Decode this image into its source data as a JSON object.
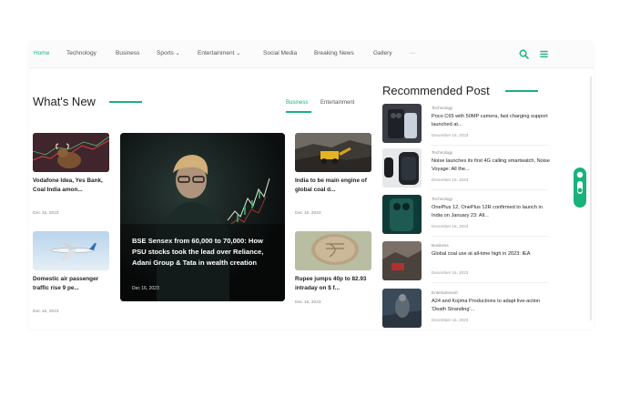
{
  "nav": {
    "items": [
      "Home",
      "Technology",
      "Business",
      "Sports",
      "Entertainment",
      "Social Media",
      "Breaking News",
      "Gallery",
      "···"
    ],
    "chevron": "⌄"
  },
  "whats_new": {
    "title": "What's New",
    "tabs": [
      "Business",
      "Entertainment"
    ]
  },
  "articles": {
    "vodafone": {
      "title": "Vodafone Idea, Yes Bank, Coal India amon...",
      "date": "Dec 16, 2023"
    },
    "air": {
      "title": "Domestic air passenger traffic rise 9 pe...",
      "date": "Dec 16, 2023"
    },
    "hero": {
      "title": "BSE Sensex from 60,000 to 70,000: How PSU stocks took the lead over Reliance, Adani Group & Tata in wealth creation",
      "date": "Dec 16, 2023"
    },
    "coal": {
      "title": "India to be main engine of global coal d...",
      "date": "Dec 16, 2023"
    },
    "rupee": {
      "title": "Rupee jumps 40p to 82.93 intraday on $ f...",
      "date": "Dec 16, 2023"
    }
  },
  "recommended": {
    "title": "Recommended Post",
    "items": [
      {
        "category": "Technology",
        "title": "Poco C65 with 50MP camera, fast charging support launched at...",
        "date": "December 16, 2023"
      },
      {
        "category": "Technology",
        "title": "Noise launches its first 4G calling smartwatch, Noise Voyage: All the...",
        "date": "December 16, 2023"
      },
      {
        "category": "Technology",
        "title": "OnePlus 12, OnePlus 12R confirmed to launch in India on January 23: All...",
        "date": "December 16, 2023"
      },
      {
        "category": "Business",
        "title": "Global coal use at all-time high in 2023: IEA",
        "date": "December 16, 2023"
      },
      {
        "category": "Entertainment",
        "title": "A24 and Kojima Productions to adapt live-action 'Death Stranding'...",
        "date": "December 16, 2023"
      }
    ]
  },
  "colors": {
    "accent": "#19b27b"
  },
  "icons": {
    "search": "search-icon",
    "menu": "menu-icon",
    "theme_toggle": "theme-toggle-icon"
  }
}
